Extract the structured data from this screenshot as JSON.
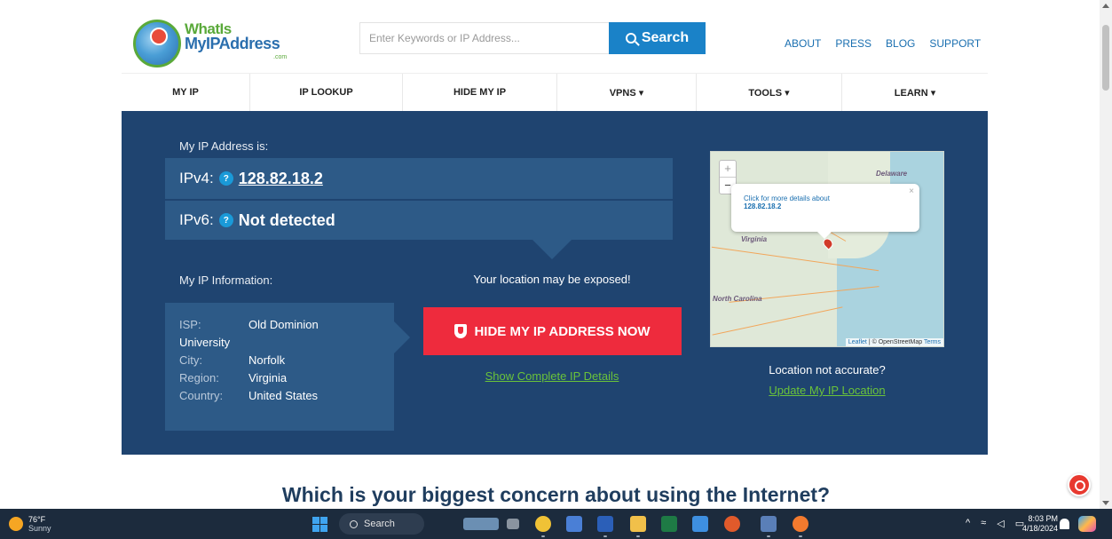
{
  "header": {
    "logo_line1": "WhatIs",
    "logo_line2": "MyIPAddress",
    "logo_com": ".com",
    "search_placeholder": "Enter Keywords or IP Address...",
    "search_button": "Search",
    "links": [
      "ABOUT",
      "PRESS",
      "BLOG",
      "SUPPORT"
    ]
  },
  "nav": [
    "MY IP",
    "IP LOOKUP",
    "HIDE MY IP",
    "VPNS ▾",
    "TOOLS ▾",
    "LEARN ▾"
  ],
  "hero": {
    "my_ip_label": "My IP Address is:",
    "ipv4_label": "IPv4:",
    "ipv4_value": "128.82.18.2",
    "ipv6_label": "IPv6:",
    "ipv6_value": "Not detected",
    "help_glyph": "?",
    "info_label": "My IP Information:",
    "isp_key": "ISP:",
    "isp_val_1": "Old Dominion",
    "isp_val_2": "University",
    "city_key": "City:",
    "city_val": "Norfolk",
    "region_key": "Region:",
    "region_val": "Virginia",
    "country_key": "Country:",
    "country_val": "United States",
    "exposed_text": "Your location may be exposed!",
    "hide_button": "HIDE MY IP ADDRESS NOW",
    "show_details": "Show Complete IP Details",
    "not_accurate": "Location not accurate?",
    "update_location": "Update My IP Location"
  },
  "map": {
    "zoom_in": "+",
    "zoom_out": "−",
    "label_delaware": "Delaware",
    "label_virginia": "Virginia",
    "label_nc": "North Carolina",
    "popup_text": "Click for more details about",
    "popup_ip": "128.82.18.2",
    "popup_close": "×",
    "attrib_leaflet": "Leaflet",
    "attrib_sep": " | © OpenStreetMap ",
    "attrib_terms": "Terms"
  },
  "concern_heading": "Which is your biggest concern about using the Internet?",
  "taskbar": {
    "temp": "76°F",
    "weather": "Sunny",
    "search": "Search",
    "time": "8:03 PM",
    "date": "4/18/2024",
    "tray_caret": "^"
  },
  "colors": {
    "hero_bg": "#1f4470",
    "panel_bg": "#2d5a87",
    "accent_blue": "#1a82c8",
    "hide_red": "#ee2b3d",
    "link_green": "#6ac33a"
  }
}
